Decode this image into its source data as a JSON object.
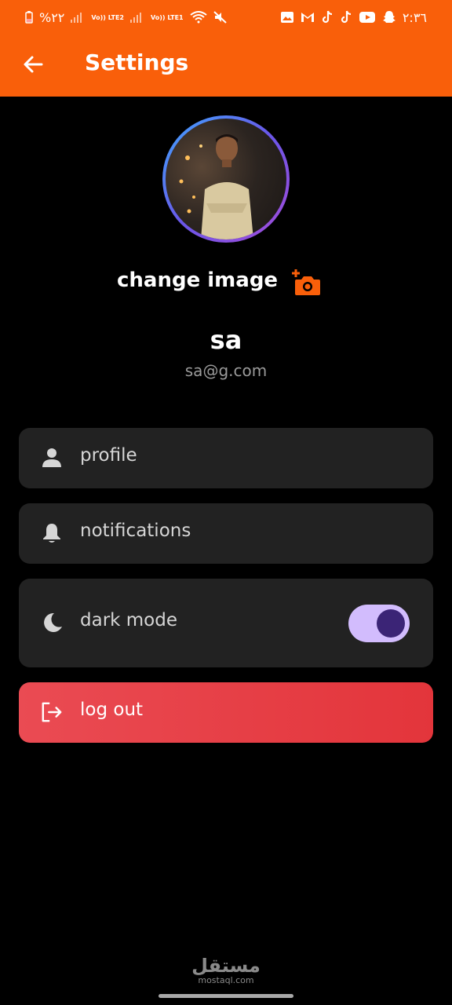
{
  "status_bar": {
    "battery_percent": "%٢٢",
    "sim1_label": "Vo)) LTE2",
    "sim2_label": "Vo)) LTE1",
    "time": "٢:٣٦",
    "left_icons": [
      "battery-icon",
      "signal-icon",
      "signal-icon",
      "wifi-icon",
      "mute-icon"
    ],
    "right_icons": [
      "gallery-icon",
      "gmail-icon",
      "tiktok-icon",
      "tiktok-icon",
      "youtube-icon",
      "snapchat-icon"
    ]
  },
  "app_bar": {
    "title": "Settings",
    "back_icon": "arrow-left-icon"
  },
  "profile": {
    "change_image_label": "change image",
    "camera_icon": "add-camera-icon",
    "name": "sa",
    "email": "sa@g.com"
  },
  "menu": {
    "profile_label": "profile",
    "notifications_label": "notifications",
    "dark_mode_label": "dark mode",
    "dark_mode_on": true,
    "logout_label": "log out"
  },
  "watermark": {
    "arabic": "مستقل",
    "latin": "mostaql.com"
  },
  "colors": {
    "header": "#f95f0a",
    "background": "#000000",
    "card": "#222222",
    "logout": "#e3353b",
    "toggle_track": "#d2bcfd",
    "toggle_knob": "#3b2476"
  }
}
